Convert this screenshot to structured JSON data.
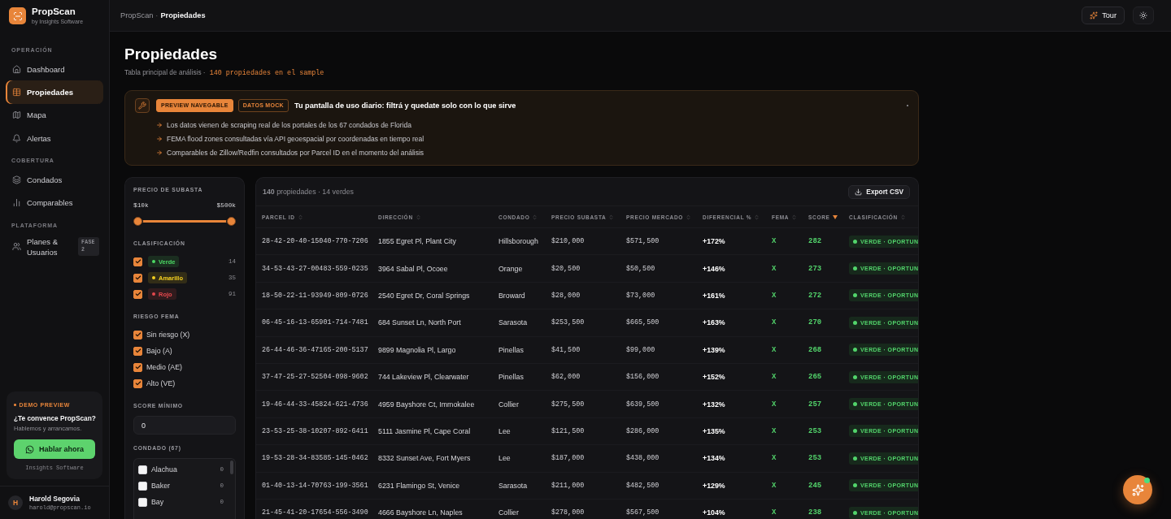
{
  "sidebar": {
    "brand": {
      "name": "PropScan",
      "tagline": "by Insights Software"
    },
    "sections": [
      {
        "title": "OPERACIÓN",
        "items": [
          {
            "label": "Dashboard",
            "selected": false
          },
          {
            "label": "Propiedades",
            "selected": true
          },
          {
            "label": "Mapa",
            "selected": false
          },
          {
            "label": "Alertas",
            "selected": false
          }
        ]
      },
      {
        "title": "COBERTURA",
        "items": [
          {
            "label": "Condados",
            "selected": false
          },
          {
            "label": "Comparables",
            "selected": false
          }
        ]
      },
      {
        "title": "PLATAFORMA",
        "items": [
          {
            "label": "Planes & Usuarios",
            "selected": false,
            "badge": "FASE 2"
          }
        ]
      }
    ],
    "promo": {
      "eyebrow": "DEMO PREVIEW",
      "title": "¿Te convence PropScan?",
      "text": "Hablemos y arrancamos.",
      "button": "Hablar ahora",
      "footer": "Insights Software"
    },
    "user": {
      "initial": "H",
      "name": "Harold Segovia",
      "email": "harold@propscan.io"
    }
  },
  "topbar": {
    "breadcrumb": [
      {
        "label": "PropScan",
        "current": false
      },
      {
        "label": "Propiedades",
        "current": true
      }
    ],
    "separator": "·",
    "tour_button": "Tour"
  },
  "header": {
    "title": "Propiedades",
    "subtitle": "Tabla principal de análisis ·",
    "sample_note": "140 propiedades en el sample"
  },
  "banner": {
    "badges": [
      {
        "label": "PREVIEW NAVEGABLE",
        "kind": "filled"
      },
      {
        "label": "DATOS MOCK",
        "kind": "outline"
      }
    ],
    "title": "Tu pantalla de uso diario: filtrá y quedate solo con lo que sirve",
    "bullets": [
      "Los datos vienen de scraping real de los portales de los 67 condados de Florida",
      "FEMA flood zones consultadas vía API geoespacial por coordenadas en tiempo real",
      "Comparables de Zillow/Redfin consultados por Parcel ID en el momento del análisis"
    ]
  },
  "filters": {
    "price": {
      "title": "PRECIO DE SUBASTA",
      "min": "$10k",
      "max": "$500k",
      "handles": [
        {
          "level": 0
        },
        {
          "level": 1
        }
      ]
    },
    "classification": {
      "title": "CLASIFICACIÓN",
      "options": [
        {
          "label": "Verde",
          "color": "#4cd964",
          "checked": true,
          "count": "14"
        },
        {
          "label": "Amarillo",
          "color": "#f5d020",
          "checked": true,
          "count": "35"
        },
        {
          "label": "Rojo",
          "color": "#e5484d",
          "checked": true,
          "count": "91"
        }
      ]
    },
    "fema": {
      "title": "RIESGO FEMA",
      "options": [
        {
          "label": "Sin riesgo (X)",
          "checked": true
        },
        {
          "label": "Bajo (A)",
          "checked": true
        },
        {
          "label": "Medio (AE)",
          "checked": true
        },
        {
          "label": "Alto (VE)",
          "checked": true
        }
      ]
    },
    "score": {
      "title": "SCORE MÍNIMO",
      "value": "0"
    },
    "county": {
      "title": "CONDADO (67)",
      "options": [
        {
          "label": "Alachua",
          "checked": false,
          "count": "0"
        },
        {
          "label": "Baker",
          "checked": false,
          "count": "0"
        },
        {
          "label": "Bay",
          "checked": false,
          "count": "0"
        }
      ]
    }
  },
  "table": {
    "summary": "**140** propiedades · 14 verdes",
    "export_button": "Export CSV",
    "columns": [
      {
        "label": "PARCEL ID",
        "sorted": false
      },
      {
        "label": "DIRECCIÓN",
        "sorted": false
      },
      {
        "label": "CONDADO",
        "sorted": false
      },
      {
        "label": "PRECIO SUBASTA",
        "sorted": false
      },
      {
        "label": "PRECIO MERCADO",
        "sorted": false
      },
      {
        "label": "DIFERENCIAL %",
        "sorted": false
      },
      {
        "label": "FEMA",
        "sorted": false
      },
      {
        "label": "SCORE",
        "sorted": true
      },
      {
        "label": "CLASIFICACIÓN",
        "sorted": false
      }
    ],
    "rows": [
      {
        "parcel_id": "28-42-20-40-15040-770-7206",
        "address": "1855 Egret Pl, Plant City",
        "county": "Hillsborough",
        "auction_price": "$210,000",
        "market_price": "$571,500",
        "differential": "+172%",
        "fema": "X",
        "score": "282",
        "classification": "VERDE · OPORTUN"
      },
      {
        "parcel_id": "34-53-43-27-00483-559-0235",
        "address": "3964 Sabal Pl, Ocoee",
        "county": "Orange",
        "auction_price": "$20,500",
        "market_price": "$50,500",
        "differential": "+146%",
        "fema": "X",
        "score": "273",
        "classification": "VERDE · OPORTUN"
      },
      {
        "parcel_id": "18-50-22-11-93949-809-0726",
        "address": "2540 Egret Dr, Coral Springs",
        "county": "Broward",
        "auction_price": "$28,000",
        "market_price": "$73,000",
        "differential": "+161%",
        "fema": "X",
        "score": "272",
        "classification": "VERDE · OPORTUN"
      },
      {
        "parcel_id": "06-45-16-13-65901-714-7481",
        "address": "684 Sunset Ln, North Port",
        "county": "Sarasota",
        "auction_price": "$253,500",
        "market_price": "$665,500",
        "differential": "+163%",
        "fema": "X",
        "score": "270",
        "classification": "VERDE · OPORTUN"
      },
      {
        "parcel_id": "26-44-46-36-47165-200-5137",
        "address": "9899 Magnolia Pl, Largo",
        "county": "Pinellas",
        "auction_price": "$41,500",
        "market_price": "$99,000",
        "differential": "+139%",
        "fema": "X",
        "score": "268",
        "classification": "VERDE · OPORTUN"
      },
      {
        "parcel_id": "37-47-25-27-52504-098-9602",
        "address": "744 Lakeview Pl, Clearwater",
        "county": "Pinellas",
        "auction_price": "$62,000",
        "market_price": "$156,000",
        "differential": "+152%",
        "fema": "X",
        "score": "265",
        "classification": "VERDE · OPORTUN"
      },
      {
        "parcel_id": "19-46-44-33-45824-621-4736",
        "address": "4959 Bayshore Ct, Immokalee",
        "county": "Collier",
        "auction_price": "$275,500",
        "market_price": "$639,500",
        "differential": "+132%",
        "fema": "X",
        "score": "257",
        "classification": "VERDE · OPORTUN"
      },
      {
        "parcel_id": "23-53-25-38-10207-892-6411",
        "address": "5111 Jasmine Pl, Cape Coral",
        "county": "Lee",
        "auction_price": "$121,500",
        "market_price": "$286,000",
        "differential": "+135%",
        "fema": "X",
        "score": "253",
        "classification": "VERDE · OPORTUN"
      },
      {
        "parcel_id": "19-53-28-34-83585-145-0462",
        "address": "8332 Sunset Ave, Fort Myers",
        "county": "Lee",
        "auction_price": "$187,000",
        "market_price": "$438,000",
        "differential": "+134%",
        "fema": "X",
        "score": "253",
        "classification": "VERDE · OPORTUN"
      },
      {
        "parcel_id": "01-40-13-14-70763-199-3561",
        "address": "6231 Flamingo St, Venice",
        "county": "Sarasota",
        "auction_price": "$211,000",
        "market_price": "$482,500",
        "differential": "+129%",
        "fema": "X",
        "score": "245",
        "classification": "VERDE · OPORTUN"
      },
      {
        "parcel_id": "21-45-41-20-17654-556-3490",
        "address": "4666 Bayshore Ln, Naples",
        "county": "Collier",
        "auction_price": "$278,000",
        "market_price": "$567,500",
        "differential": "+104%",
        "fema": "X",
        "score": "238",
        "classification": "VERDE · OPORTUN"
      }
    ]
  },
  "assistant": {
    "online": true
  }
}
